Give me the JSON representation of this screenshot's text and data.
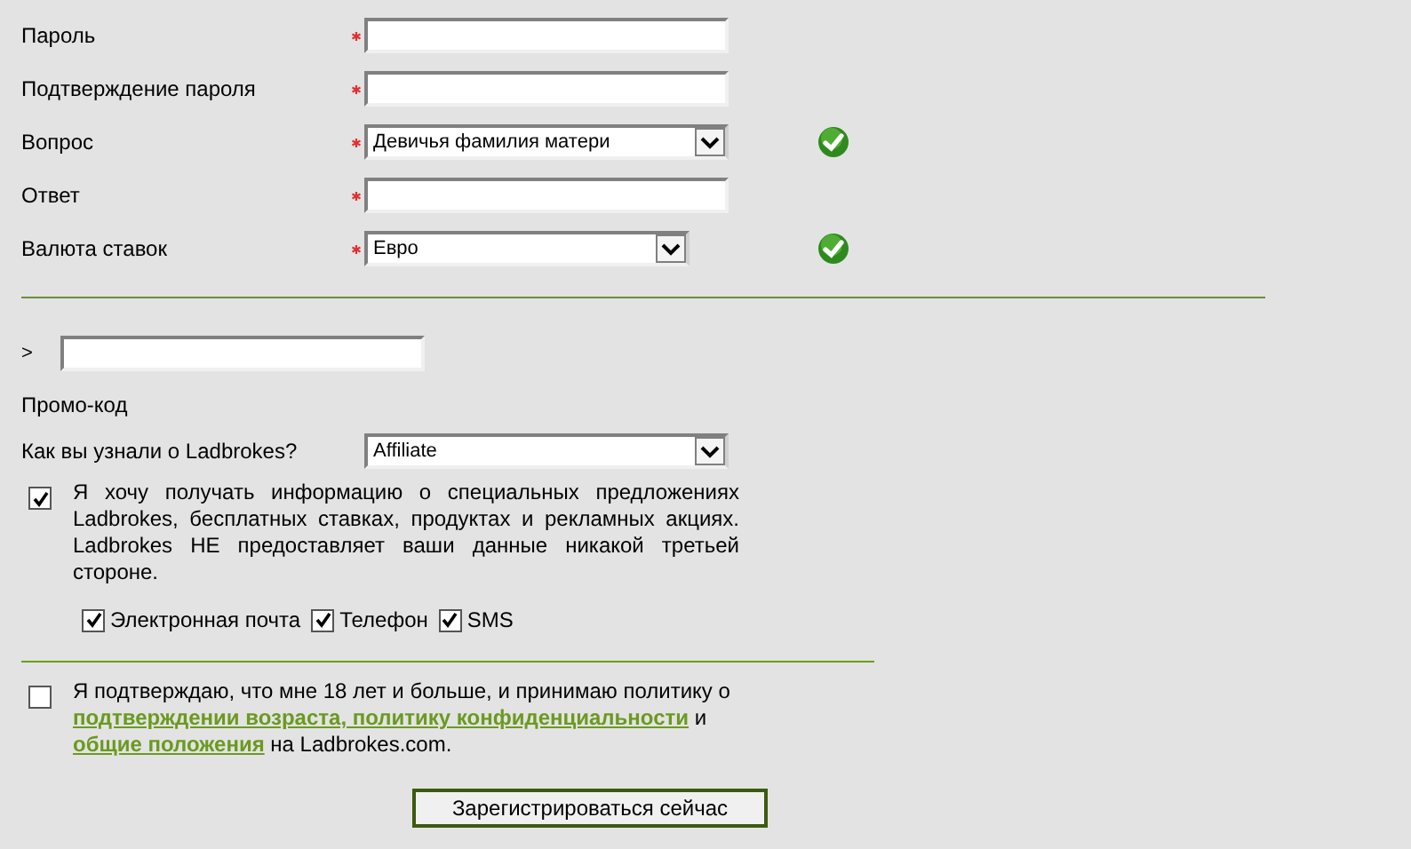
{
  "fields": [
    {
      "label": "Пароль",
      "kind": "text",
      "required": true,
      "valid": false
    },
    {
      "label": "Подтверждение пароля",
      "kind": "text",
      "required": true,
      "valid": false
    },
    {
      "label": "Вопрос",
      "kind": "select",
      "required": true,
      "value": "Девичья фамилия матери",
      "valid": true
    },
    {
      "label": "Ответ",
      "kind": "text",
      "required": true,
      "valid": false
    },
    {
      "label": "Валюта ставок",
      "kind": "select",
      "required": true,
      "value": "Евро",
      "valid": true
    }
  ],
  "promo": {
    "prefix": ">",
    "label": "Промо-код"
  },
  "source": {
    "label": "Как вы узнали о Ladbrokes?",
    "value": "Affiliate"
  },
  "marketing": {
    "checked": true,
    "text": "Я хочу получать информацию о специальных предложениях Ladbrokes, бесплатных ставках, продуктах и рекламных акциях. Ladbrokes НЕ предоставляет ваши данные никакой третьей стороне.",
    "channels": [
      {
        "label": "Электронная почта",
        "checked": true
      },
      {
        "label": "Телефон",
        "checked": true
      },
      {
        "label": "SMS",
        "checked": true
      }
    ]
  },
  "consent": {
    "checked": false,
    "before": "Я подтверждаю, что мне 18 лет и больше, и принимаю политику о",
    "link_1": "подтверждении возраста, политику конфиденциальности",
    "middle": "и",
    "link_2": "общие положения",
    "after": "на Ladbrokes.com."
  },
  "submit": "Зарегистрироваться сейчас"
}
